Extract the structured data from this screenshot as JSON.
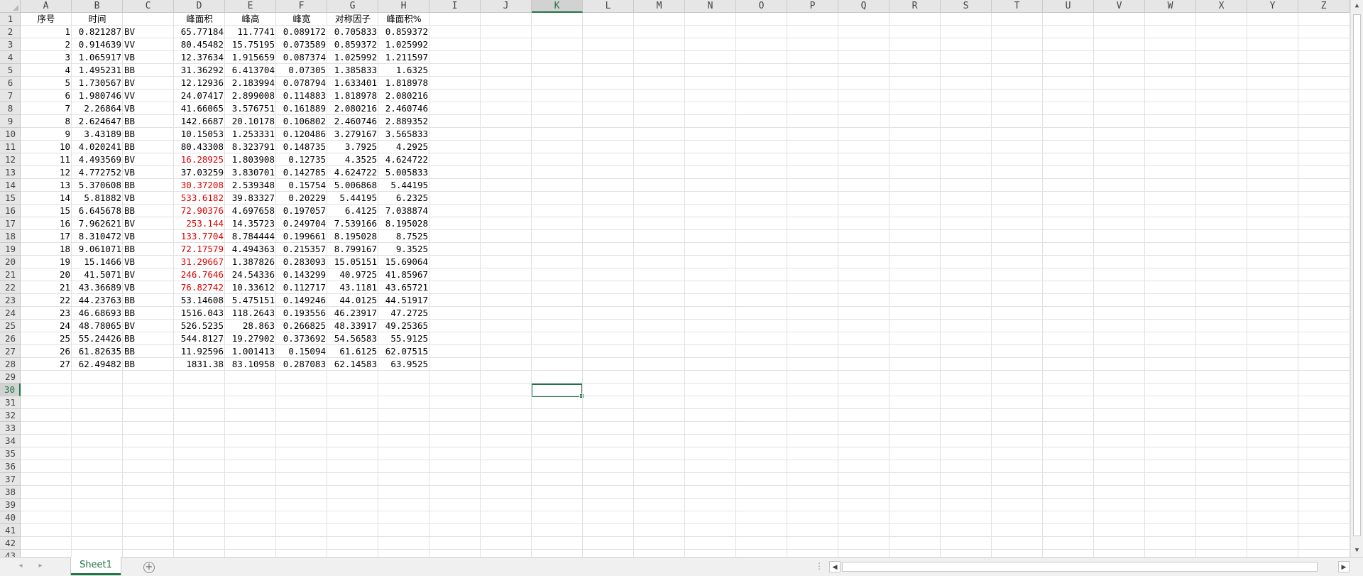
{
  "columns": [
    "A",
    "B",
    "C",
    "D",
    "E",
    "F",
    "G",
    "H",
    "I",
    "J",
    "K",
    "L",
    "M",
    "N",
    "O",
    "P",
    "Q",
    "R",
    "S",
    "T",
    "U",
    "V",
    "W",
    "X",
    "Y",
    "Z"
  ],
  "rows": [
    "1",
    "2",
    "3",
    "4",
    "5",
    "6",
    "7",
    "8",
    "9",
    "10",
    "11",
    "12",
    "13",
    "14",
    "15",
    "16",
    "17",
    "18",
    "19",
    "20",
    "21",
    "22",
    "23",
    "24",
    "25",
    "26",
    "27",
    "28",
    "29",
    "30",
    "31",
    "32",
    "33",
    "34",
    "35",
    "36",
    "37",
    "38",
    "39",
    "40",
    "41",
    "42",
    "43"
  ],
  "selected_column": "K",
  "selected_row": "30",
  "headers": [
    "序号",
    "时间",
    "",
    "峰面积",
    "峰高",
    "峰宽",
    "对称因子",
    "峰面积%"
  ],
  "table": [
    [
      "1",
      "0.821287",
      "BV",
      "65.77184",
      "11.7741",
      "0.089172",
      "0.705833",
      "0.859372"
    ],
    [
      "2",
      "0.914639",
      "VV",
      "80.45482",
      "15.75195",
      "0.073589",
      "0.859372",
      "1.025992"
    ],
    [
      "3",
      "1.065917",
      "VB",
      "12.37634",
      "1.915659",
      "0.087374",
      "1.025992",
      "1.211597"
    ],
    [
      "4",
      "1.495231",
      "BB",
      "31.36292",
      "6.413704",
      "0.07305",
      "1.385833",
      "1.6325"
    ],
    [
      "5",
      "1.730567",
      "BV",
      "12.12936",
      "2.183994",
      "0.078794",
      "1.633401",
      "1.818978"
    ],
    [
      "6",
      "1.980746",
      "VV",
      "24.07417",
      "2.899008",
      "0.114883",
      "1.818978",
      "2.080216"
    ],
    [
      "7",
      "2.26864",
      "VB",
      "41.66065",
      "3.576751",
      "0.161889",
      "2.080216",
      "2.460746"
    ],
    [
      "8",
      "2.624647",
      "BB",
      "142.6687",
      "20.10178",
      "0.106802",
      "2.460746",
      "2.889352"
    ],
    [
      "9",
      "3.43189",
      "BB",
      "10.15053",
      "1.253331",
      "0.120486",
      "3.279167",
      "3.565833"
    ],
    [
      "10",
      "4.020241",
      "BB",
      "80.43308",
      "8.323791",
      "0.148735",
      "3.7925",
      "4.2925"
    ],
    [
      "11",
      "4.493569",
      "BV",
      "16.28925",
      "1.803908",
      "0.12735",
      "4.3525",
      "4.624722"
    ],
    [
      "12",
      "4.772752",
      "VB",
      "37.03259",
      "3.830701",
      "0.142785",
      "4.624722",
      "5.005833"
    ],
    [
      "13",
      "5.370608",
      "BB",
      "30.37208",
      "2.539348",
      "0.15754",
      "5.006868",
      "5.44195"
    ],
    [
      "14",
      "5.81882",
      "VB",
      "533.6182",
      "39.83327",
      "0.20229",
      "5.44195",
      "6.2325"
    ],
    [
      "15",
      "6.645678",
      "BB",
      "72.90376",
      "4.697658",
      "0.197057",
      "6.4125",
      "7.038874"
    ],
    [
      "16",
      "7.962621",
      "BV",
      "253.144",
      "14.35723",
      "0.249704",
      "7.539166",
      "8.195028"
    ],
    [
      "17",
      "8.310472",
      "VB",
      "133.7704",
      "8.784444",
      "0.199661",
      "8.195028",
      "8.7525"
    ],
    [
      "18",
      "9.061071",
      "BB",
      "72.17579",
      "4.494363",
      "0.215357",
      "8.799167",
      "9.3525"
    ],
    [
      "19",
      "15.1466",
      "VB",
      "31.29667",
      "1.387826",
      "0.283093",
      "15.05151",
      "15.69064"
    ],
    [
      "20",
      "41.5071",
      "BV",
      "246.7646",
      "24.54336",
      "0.143299",
      "40.9725",
      "41.85967"
    ],
    [
      "21",
      "43.36689",
      "VB",
      "76.82742",
      "10.33612",
      "0.112717",
      "43.1181",
      "43.65721"
    ],
    [
      "22",
      "44.23763",
      "BB",
      "53.14608",
      "5.475151",
      "0.149246",
      "44.0125",
      "44.51917"
    ],
    [
      "23",
      "46.68693",
      "BB",
      "1516.043",
      "118.2643",
      "0.193556",
      "46.23917",
      "47.2725"
    ],
    [
      "24",
      "48.78065",
      "BV",
      "526.5235",
      "28.863",
      "0.266825",
      "48.33917",
      "49.25365"
    ],
    [
      "25",
      "55.24426",
      "BB",
      "544.8127",
      "19.27902",
      "0.373692",
      "54.56583",
      "55.9125"
    ],
    [
      "26",
      "61.82635",
      "BB",
      "11.92596",
      "1.001413",
      "0.15094",
      "61.6125",
      "62.07515"
    ],
    [
      "27",
      "62.49482",
      "BB",
      "1831.38",
      "83.10958",
      "0.287083",
      "62.14583",
      "63.9525"
    ]
  ],
  "red_cells": [
    "10:3",
    "12:3",
    "13:3",
    "14:3",
    "15:3",
    "16:3",
    "17:3",
    "18:3",
    "19:3",
    "20:3"
  ],
  "text_color_red": "#e00000",
  "accent_color": "#217346",
  "sheet_tab": {
    "label": "Sheet1"
  },
  "icons": {
    "prev_sheet": "◂",
    "next_sheet": "▸",
    "add_sheet": "+",
    "more": "⋮",
    "scroll_up": "▲",
    "scroll_down": "▼",
    "scroll_left": "◀",
    "scroll_right": "▶"
  }
}
